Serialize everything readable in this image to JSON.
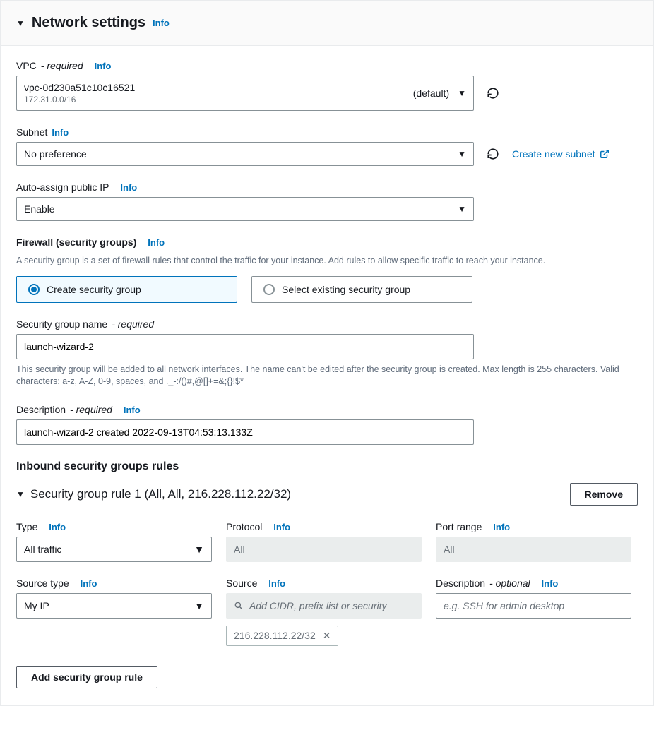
{
  "header": {
    "title": "Network settings",
    "info": "Info"
  },
  "vpc": {
    "label": "VPC",
    "required": "- required",
    "info": "Info",
    "selected_id": "vpc-0d230a51c10c16521",
    "selected_cidr": "172.31.0.0/16",
    "default_tag": "(default)"
  },
  "subnet": {
    "label": "Subnet",
    "info": "Info",
    "selected": "No preference",
    "create_link": "Create new subnet"
  },
  "auto_ip": {
    "label": "Auto-assign public IP",
    "info": "Info",
    "selected": "Enable"
  },
  "firewall": {
    "label": "Firewall (security groups)",
    "info": "Info",
    "help": "A security group is a set of firewall rules that control the traffic for your instance. Add rules to allow specific traffic to reach your instance.",
    "option_create": "Create security group",
    "option_select": "Select existing security group"
  },
  "sg_name": {
    "label": "Security group name",
    "required": "- required",
    "value": "launch-wizard-2",
    "help": "This security group will be added to all network interfaces. The name can't be edited after the security group is created. Max length is 255 characters. Valid characters: a-z, A-Z, 0-9, spaces, and ._-:/()#,@[]+=&;{}!$*"
  },
  "sg_desc": {
    "label": "Description",
    "required": "- required",
    "info": "Info",
    "value": "launch-wizard-2 created 2022-09-13T04:53:13.133Z"
  },
  "inbound": {
    "heading": "Inbound security groups rules",
    "rule_title": "Security group rule 1 (All, All, 216.228.112.22/32)",
    "remove": "Remove"
  },
  "rule": {
    "type_label": "Type",
    "type_info": "Info",
    "type_value": "All traffic",
    "protocol_label": "Protocol",
    "protocol_info": "Info",
    "protocol_value": "All",
    "port_label": "Port range",
    "port_info": "Info",
    "port_value": "All",
    "source_type_label": "Source type",
    "source_type_info": "Info",
    "source_type_value": "My IP",
    "source_label": "Source",
    "source_info": "Info",
    "source_placeholder": "Add CIDR, prefix list or security",
    "source_chip": "216.228.112.22/32",
    "desc_label": "Description",
    "desc_optional": "- optional",
    "desc_info": "Info",
    "desc_placeholder": "e.g. SSH for admin desktop"
  },
  "add_rule_btn": "Add security group rule"
}
